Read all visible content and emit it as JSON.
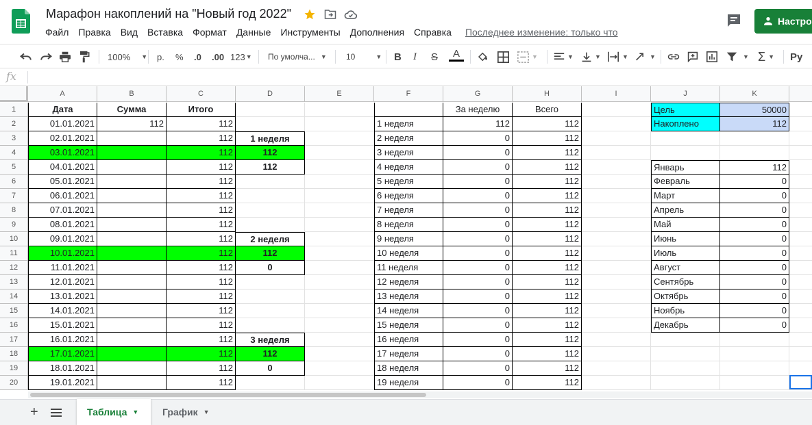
{
  "doc": {
    "title": "Марафон накоплений на \"Новый год 2022\"",
    "last_edit": "Последнее изменение: только что",
    "share_label": "Настро"
  },
  "menu": [
    "Файл",
    "Правка",
    "Вид",
    "Вставка",
    "Формат",
    "Данные",
    "Инструменты",
    "Дополнения",
    "Справка"
  ],
  "toolbar": {
    "zoom": "100%",
    "currency": "р.",
    "percent": "%",
    "dec_less": ".0",
    "dec_more": ".00",
    "format_more": "123",
    "font": "По умолча...",
    "font_size": "10",
    "input_tools": "Ру"
  },
  "formula_bar": {
    "fx": "fx"
  },
  "columns": [
    "A",
    "B",
    "C",
    "D",
    "E",
    "F",
    "G",
    "H",
    "I",
    "J",
    "K"
  ],
  "rows": [
    {
      "n": "1",
      "a": "Дата",
      "b": "Сумма",
      "c": "Итого",
      "d": "",
      "f": "",
      "g": "За неделю",
      "h": "Всего",
      "j": "Цель",
      "k": "50000",
      "green": false
    },
    {
      "n": "2",
      "a": "01.01.2021",
      "b": "112",
      "c": "112",
      "d": "",
      "f": "1 неделя",
      "g": "112",
      "h": "112",
      "j": "Накоплено",
      "k": "112",
      "green": false
    },
    {
      "n": "3",
      "a": "02.01.2021",
      "b": "",
      "c": "112",
      "d": "1 неделя",
      "f": "2 неделя",
      "g": "0",
      "h": "112",
      "j": "",
      "k": "",
      "green": false
    },
    {
      "n": "4",
      "a": "03.01.2021",
      "b": "",
      "c": "112",
      "d": "112",
      "f": "3 неделя",
      "g": "0",
      "h": "112",
      "j": "",
      "k": "",
      "green": true
    },
    {
      "n": "5",
      "a": "04.01.2021",
      "b": "",
      "c": "112",
      "d": "112",
      "f": "4 неделя",
      "g": "0",
      "h": "112",
      "j": "Январь",
      "k": "112",
      "green": false
    },
    {
      "n": "6",
      "a": "05.01.2021",
      "b": "",
      "c": "112",
      "d": "",
      "f": "5 неделя",
      "g": "0",
      "h": "112",
      "j": "Февраль",
      "k": "0",
      "green": false
    },
    {
      "n": "7",
      "a": "06.01.2021",
      "b": "",
      "c": "112",
      "d": "",
      "f": "6 неделя",
      "g": "0",
      "h": "112",
      "j": "Март",
      "k": "0",
      "green": false
    },
    {
      "n": "8",
      "a": "07.01.2021",
      "b": "",
      "c": "112",
      "d": "",
      "f": "7 неделя",
      "g": "0",
      "h": "112",
      "j": "Апрель",
      "k": "0",
      "green": false
    },
    {
      "n": "9",
      "a": "08.01.2021",
      "b": "",
      "c": "112",
      "d": "",
      "f": "8 неделя",
      "g": "0",
      "h": "112",
      "j": "Май",
      "k": "0",
      "green": false
    },
    {
      "n": "10",
      "a": "09.01.2021",
      "b": "",
      "c": "112",
      "d": "2 неделя",
      "f": "9 неделя",
      "g": "0",
      "h": "112",
      "j": "Июнь",
      "k": "0",
      "green": false
    },
    {
      "n": "11",
      "a": "10.01.2021",
      "b": "",
      "c": "112",
      "d": "112",
      "f": "10 неделя",
      "g": "0",
      "h": "112",
      "j": "Июль",
      "k": "0",
      "green": true
    },
    {
      "n": "12",
      "a": "11.01.2021",
      "b": "",
      "c": "112",
      "d": "0",
      "f": "11 неделя",
      "g": "0",
      "h": "112",
      "j": "Август",
      "k": "0",
      "green": false
    },
    {
      "n": "13",
      "a": "12.01.2021",
      "b": "",
      "c": "112",
      "d": "",
      "f": "12 неделя",
      "g": "0",
      "h": "112",
      "j": "Сентябрь",
      "k": "0",
      "green": false
    },
    {
      "n": "14",
      "a": "13.01.2021",
      "b": "",
      "c": "112",
      "d": "",
      "f": "13 неделя",
      "g": "0",
      "h": "112",
      "j": "Октябрь",
      "k": "0",
      "green": false
    },
    {
      "n": "15",
      "a": "14.01.2021",
      "b": "",
      "c": "112",
      "d": "",
      "f": "14 неделя",
      "g": "0",
      "h": "112",
      "j": "Ноябрь",
      "k": "0",
      "green": false
    },
    {
      "n": "16",
      "a": "15.01.2021",
      "b": "",
      "c": "112",
      "d": "",
      "f": "15 неделя",
      "g": "0",
      "h": "112",
      "j": "Декабрь",
      "k": "0",
      "green": false
    },
    {
      "n": "17",
      "a": "16.01.2021",
      "b": "",
      "c": "112",
      "d": "3 неделя",
      "f": "16 неделя",
      "g": "0",
      "h": "112",
      "j": "",
      "k": "",
      "green": false
    },
    {
      "n": "18",
      "a": "17.01.2021",
      "b": "",
      "c": "112",
      "d": "112",
      "f": "17 неделя",
      "g": "0",
      "h": "112",
      "j": "",
      "k": "",
      "green": true
    },
    {
      "n": "19",
      "a": "18.01.2021",
      "b": "",
      "c": "112",
      "d": "0",
      "f": "18 неделя",
      "g": "0",
      "h": "112",
      "j": "",
      "k": "",
      "green": false
    },
    {
      "n": "20",
      "a": "19.01.2021",
      "b": "",
      "c": "112",
      "d": "",
      "f": "19 неделя",
      "g": "0",
      "h": "112",
      "j": "",
      "k": "",
      "green": false
    }
  ],
  "sheets": {
    "active": "Таблица",
    "other": "График"
  },
  "colors": {
    "highlight": "#00ff00",
    "cyan": "#00ffff",
    "light_blue": "#c9daf8",
    "brand_green": "#188038"
  }
}
